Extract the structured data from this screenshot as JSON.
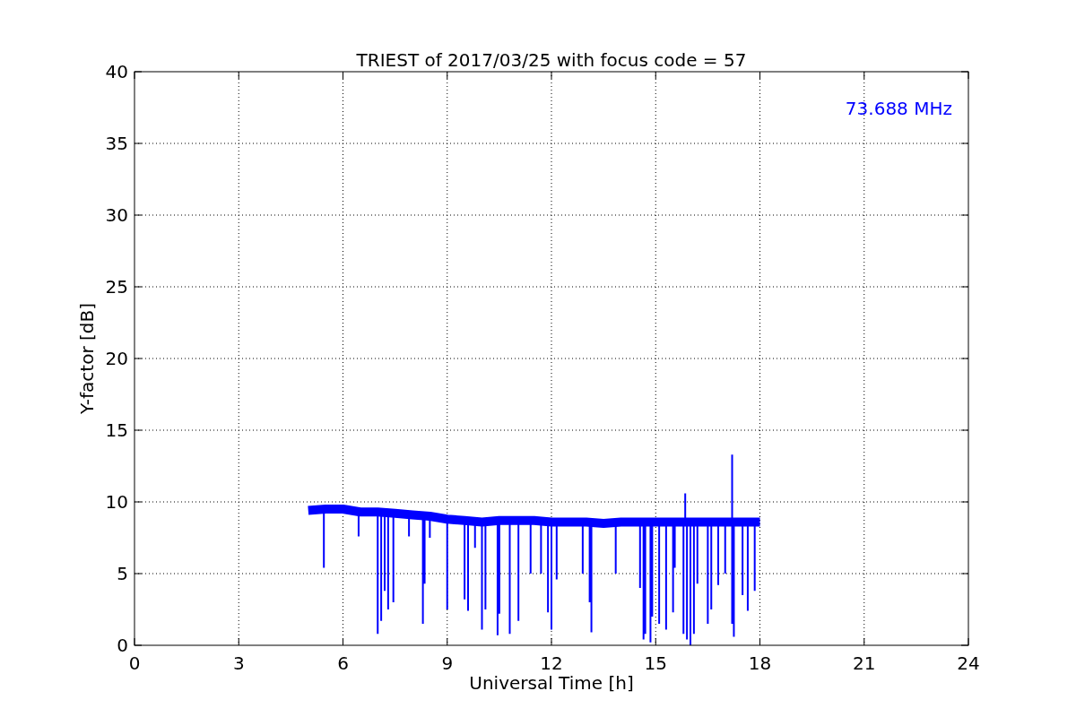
{
  "chart_data": {
    "type": "line",
    "title": "TRIEST of 2017/03/25 with focus code = 57",
    "xlabel": "Universal Time [h]",
    "ylabel": "Y-factor [dB]",
    "x": [
      5,
      5.5,
      6,
      6.5,
      7,
      7.5,
      8,
      8.5,
      9,
      9.5,
      10,
      10.5,
      11,
      11.5,
      12,
      12.5,
      13,
      13.5,
      14,
      14.5,
      15,
      15.5,
      16,
      16.5,
      17,
      17.5,
      18
    ],
    "series": [
      {
        "name": "73.688 MHz",
        "color": "#0000ff",
        "values": [
          9.4,
          9.5,
          9.5,
          9.3,
          9.3,
          9.2,
          9.1,
          9.0,
          8.8,
          8.7,
          8.6,
          8.7,
          8.7,
          8.7,
          8.6,
          8.6,
          8.6,
          8.5,
          8.6,
          8.6,
          8.6,
          8.6,
          8.6,
          8.6,
          8.6,
          8.6,
          8.6
        ]
      }
    ],
    "grid": true,
    "xlim": [
      0,
      24
    ],
    "ylim": [
      0,
      40
    ],
    "xticks": [
      0,
      3,
      6,
      9,
      12,
      15,
      18,
      21,
      24
    ],
    "yticks": [
      0,
      5,
      10,
      15,
      20,
      25,
      30,
      35,
      40
    ]
  }
}
